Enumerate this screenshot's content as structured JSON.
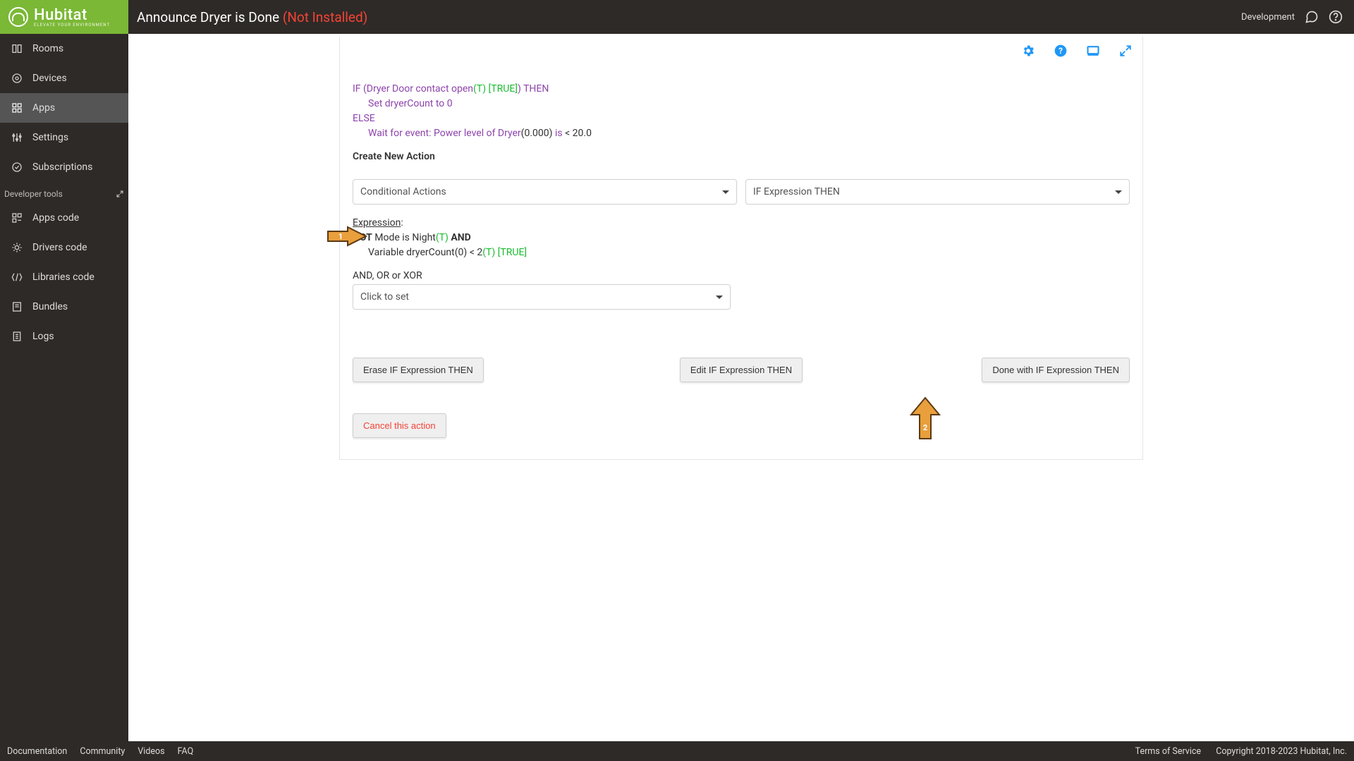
{
  "brand": {
    "name": "Hubitat",
    "tagline": "ELEVATE YOUR ENVIRONMENT"
  },
  "page": {
    "title": "Announce Dryer is Done ",
    "status": "(Not Installed)"
  },
  "header_right": {
    "mode": "Development"
  },
  "sidebar": {
    "items": [
      {
        "label": "Rooms"
      },
      {
        "label": "Devices"
      },
      {
        "label": "Apps"
      },
      {
        "label": "Settings"
      },
      {
        "label": "Subscriptions"
      }
    ],
    "section": "Developer tools",
    "dev_items": [
      {
        "label": "Apps code"
      },
      {
        "label": "Drivers code"
      },
      {
        "label": "Libraries code"
      },
      {
        "label": "Bundles"
      },
      {
        "label": "Logs"
      }
    ]
  },
  "code": {
    "line1a": "IF (Dryer Door contact open",
    "line1b": "(T)",
    "line1c": " [TRUE]",
    "line1d": ") THEN",
    "line2": "Set dryerCount to 0",
    "line3": "ELSE",
    "line4a": "Wait for event: Power level of Dryer",
    "line4b": "(0.000) ",
    "line4c": "is ",
    "line4d": "< 20.0"
  },
  "heading": "Create New Action",
  "selects": {
    "left": "Conditional Actions",
    "right": "IF Expression THEN"
  },
  "expr": {
    "title": "Expression",
    "colon": ":",
    "l1a": "NOT",
    "l1b": " Mode is Night",
    "l1c": "(T)",
    "l1d": "  AND",
    "l2a": "Variable dryerCount(0) < 2",
    "l2b": "(T)",
    "l2c": " [TRUE]"
  },
  "andor": {
    "label": "AND, OR or XOR",
    "placeholder": "Click to set"
  },
  "buttons": {
    "erase": "Erase IF Expression THEN",
    "edit": "Edit IF Expression THEN",
    "done": "Done with IF Expression THEN",
    "cancel": "Cancel this action"
  },
  "footer": {
    "left": [
      "Documentation",
      "Community",
      "Videos",
      "FAQ"
    ],
    "right": [
      "Terms of Service",
      "Copyright 2018-2023 Hubitat, Inc."
    ]
  },
  "arrows": {
    "n1": "1",
    "n2": "2"
  }
}
